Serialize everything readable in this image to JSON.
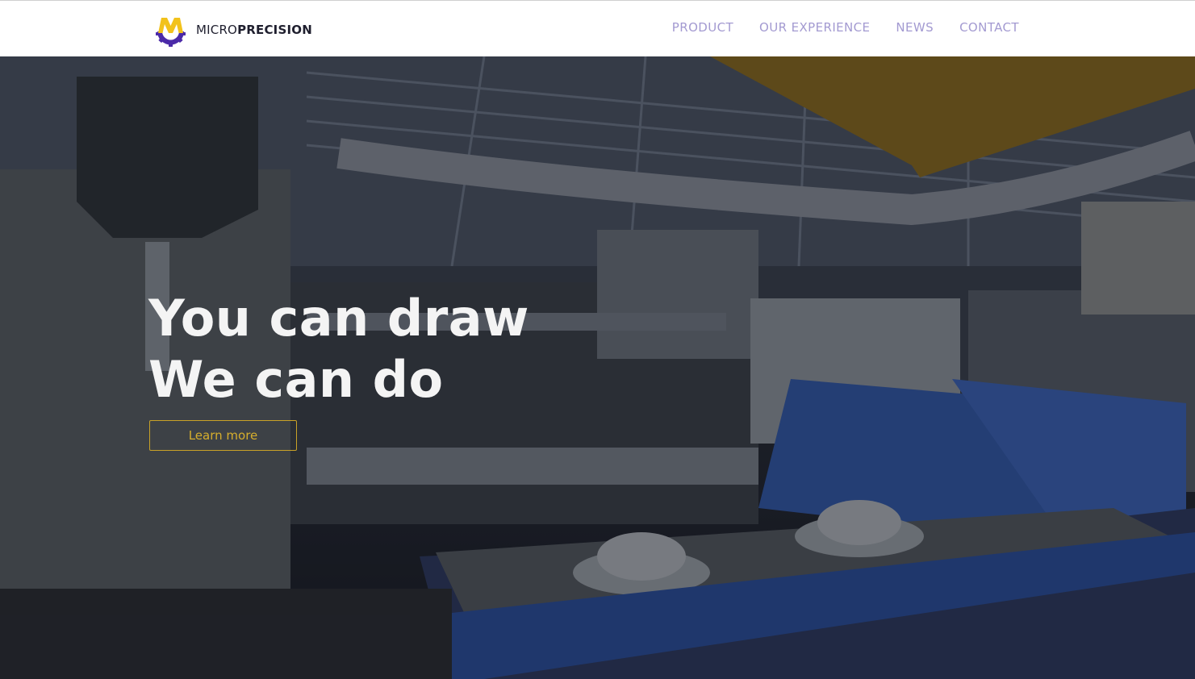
{
  "brand": {
    "name_regular": "MICRO",
    "name_bold": "PRECISION",
    "logo_icon": "gear-m-logo",
    "logo_colors": {
      "yellow": "#f2c21b",
      "purple": "#4b2aa8"
    }
  },
  "nav": {
    "items": [
      {
        "label": "PRODUCT"
      },
      {
        "label": "OUR EXPERIENCE"
      },
      {
        "label": "NEWS"
      },
      {
        "label": "CONTACT"
      }
    ],
    "color": "#a39ad1"
  },
  "hero": {
    "title_line1": "You can draw",
    "title_line2": "We can do",
    "cta_label": "Learn more",
    "cta_color": "#d6ae2d",
    "background": "factory-machinery-photo"
  }
}
